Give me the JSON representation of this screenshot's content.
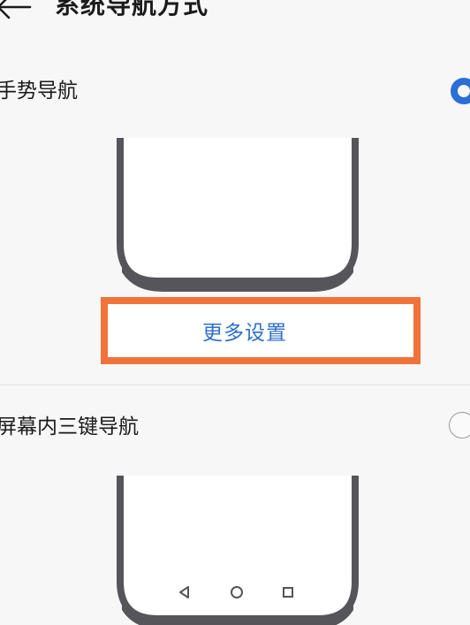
{
  "header": {
    "back_icon": "back-arrow-icon",
    "title": "系统导航方式"
  },
  "options": [
    {
      "label": "手势导航",
      "selected": true,
      "more_settings_label": "更多设置"
    },
    {
      "label": "屏幕内三键导航",
      "selected": false,
      "nav_keys": [
        "back-triangle-icon",
        "home-circle-icon",
        "recents-square-icon"
      ]
    }
  ],
  "colors": {
    "accent": "#2a6fd6",
    "link": "#2f6fc9",
    "highlight": "#f0733a",
    "phone_frame": "#55555a"
  }
}
